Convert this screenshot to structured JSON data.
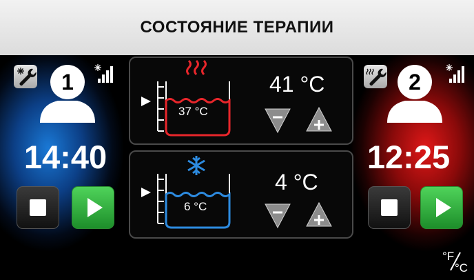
{
  "header": {
    "title": "СОСТОЯНИЕ ТЕРАПИИ"
  },
  "therapy_1": {
    "channel_number": "1",
    "time": "14:40",
    "service_icon": "snowflake-wrench-icon",
    "color": "#1a79d6"
  },
  "therapy_2": {
    "channel_number": "2",
    "time": "12:25",
    "service_icon": "heat-wrench-icon",
    "color": "#e01818"
  },
  "tank_hot": {
    "water_temp": "37 °C",
    "set_temp": "41 °C",
    "mode_icon": "heat-waves-icon",
    "color": "#e8262b"
  },
  "tank_cold": {
    "water_temp": "6 °C",
    "set_temp": "4 °C",
    "mode_icon": "snowflake-icon",
    "color": "#2d8be0"
  },
  "units": {
    "fahrenheit": "°F",
    "celsius": "°C"
  }
}
